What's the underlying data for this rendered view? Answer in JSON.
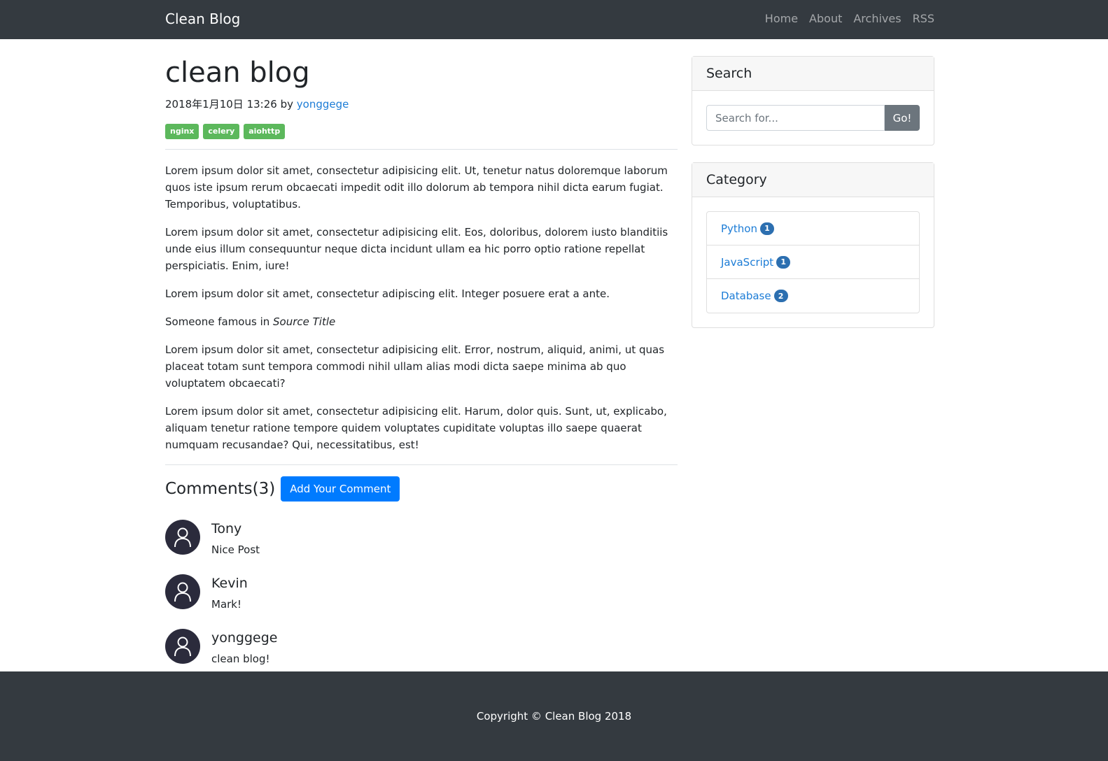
{
  "navbar": {
    "brand": "Clean Blog",
    "links": [
      "Home",
      "About",
      "Archives",
      "RSS"
    ]
  },
  "post": {
    "title": "clean blog",
    "date": "2018年1月10日 13:26",
    "by": "by",
    "author": "yonggege",
    "tags": [
      "nginx",
      "celery",
      "aiohttp"
    ],
    "paragraphs": [
      "Lorem ipsum dolor sit amet, consectetur adipisicing elit. Ut, tenetur natus doloremque laborum quos iste ipsum rerum obcaecati impedit odit illo dolorum ab tempora nihil dicta earum fugiat. Temporibus, voluptatibus.",
      "Lorem ipsum dolor sit amet, consectetur adipisicing elit. Eos, doloribus, dolorem iusto blanditiis unde eius illum consequuntur neque dicta incidunt ullam ea hic porro optio ratione repellat perspiciatis. Enim, iure!",
      "Lorem ipsum dolor sit amet, consectetur adipiscing elit. Integer posuere erat a ante."
    ],
    "quote_prefix": "Someone famous in",
    "quote_source": "Source Title",
    "paragraphs_after": [
      "Lorem ipsum dolor sit amet, consectetur adipisicing elit. Error, nostrum, aliquid, animi, ut quas placeat totam sunt tempora commodi nihil ullam alias modi dicta saepe minima ab quo voluptatem obcaecati?",
      "Lorem ipsum dolor sit amet, consectetur adipisicing elit. Harum, dolor quis. Sunt, ut, explicabo, aliquam tenetur ratione tempore quidem voluptates cupiditate voluptas illo saepe quaerat numquam recusandae? Qui, necessitatibus, est!"
    ]
  },
  "comments": {
    "title": "Comments(3)",
    "add_button": "Add Your Comment",
    "items": [
      {
        "name": "Tony",
        "text": "Nice Post"
      },
      {
        "name": "Kevin",
        "text": "Mark!"
      },
      {
        "name": "yonggege",
        "text": "clean blog!"
      }
    ]
  },
  "sidebar": {
    "search": {
      "title": "Search",
      "placeholder": "Search for...",
      "button": "Go!"
    },
    "category": {
      "title": "Category",
      "items": [
        {
          "label": "Python",
          "count": "1"
        },
        {
          "label": "JavaScript",
          "count": "1"
        },
        {
          "label": "Database",
          "count": "2"
        }
      ]
    }
  },
  "footer": {
    "text": "Copyright © Clean Blog 2018"
  },
  "colors": {
    "navbar_bg": "#343a40",
    "link": "#1c7cd6",
    "tag": "#5cb85c",
    "primary": "#007bff",
    "secondary": "#6c757d"
  },
  "icons": {
    "avatar": "user-avatar-icon"
  }
}
